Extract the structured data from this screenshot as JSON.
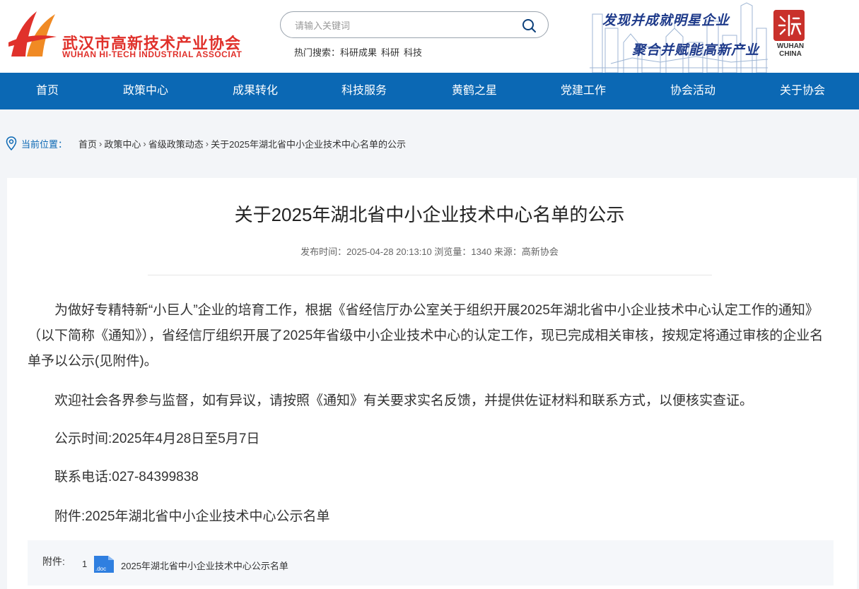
{
  "header": {
    "logo_cn": "武汉市高新技术产业协会",
    "logo_en": "WUHAN HI-TECH INDUSTRIAL ASSOCIAT",
    "search_placeholder": "请输入关键词",
    "hot_label": "热门搜索：",
    "hot_terms": [
      "科研成果",
      "科研",
      "科技"
    ],
    "slogan_line1": "发现并成就明星企业",
    "slogan_line2": "聚合并赋能高新产业",
    "seal_text": "WUHAN CHINA"
  },
  "nav": {
    "items": [
      "首页",
      "政策中心",
      "成果转化",
      "科技服务",
      "黄鹤之星",
      "党建工作",
      "协会活动",
      "关于协会"
    ]
  },
  "breadcrumb": {
    "label": "当前位置：",
    "items": [
      "首页",
      "政策中心",
      "省级政策动态",
      "关于2025年湖北省中小企业技术中心名单的公示"
    ]
  },
  "article": {
    "title": "关于2025年湖北省中小企业技术中心名单的公示",
    "meta": "发布时间：2025-04-28 20:13:10 浏览量：1340 来源：高新协会",
    "paragraphs": [
      "为做好专精特新“小巨人”企业的培育工作，根据《省经信厅办公室关于组织开展2025年湖北省中小企业技术中心认定工作的通知》（以下简称《通知》），省经信厅组织开展了2025年省级中小企业技术中心的认定工作，现已完成相关审核，按规定将通过审核的企业名单予以公示(见附件)。",
      "欢迎社会各界参与监督，如有异议，请按照《通知》有关要求实名反馈，并提供佐证材料和联系方式，以便核实查证。",
      "公示时间:2025年4月28日至5月7日",
      "联系电话:027-84399838",
      "附件:2025年湖北省中小企业技术中心公示名单"
    ],
    "attachment": {
      "label": "附件:",
      "number": "1",
      "icon_text": ".doc",
      "file_name": "2025年湖北省中小企业技术中心公示名单"
    }
  },
  "colors": {
    "nav_bg": "#0b68b4",
    "logo_red": "#e0312b",
    "slogan_blue": "#1e3a8a"
  }
}
